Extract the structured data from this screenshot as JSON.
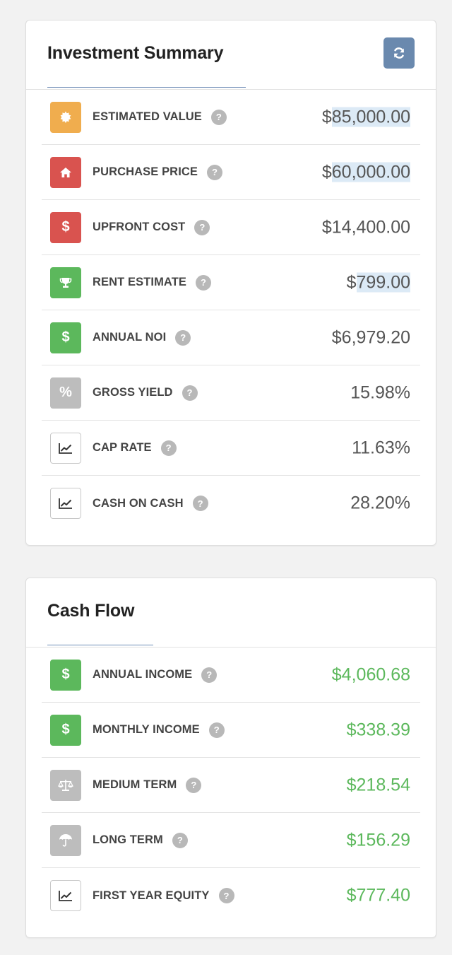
{
  "investment_summary": {
    "title": "Investment Summary",
    "refresh_icon": "refresh-icon",
    "rows": [
      {
        "label": "ESTIMATED VALUE",
        "value_prefix": "$",
        "value_main": "85,000.00",
        "icon": "certificate-icon",
        "color": "#f0ad4e"
      },
      {
        "label": "PURCHASE PRICE",
        "value_prefix": "$",
        "value_main": "60,000.00",
        "icon": "home-icon",
        "color": "#d9534f"
      },
      {
        "label": "UPFRONT COST",
        "value": "$14,400.00",
        "icon": "dollar-icon",
        "color": "#d9534f"
      },
      {
        "label": "RENT ESTIMATE",
        "value_prefix": "$",
        "value_main": "799.00",
        "icon": "trophy-icon",
        "color": "#5cb85c"
      },
      {
        "label": "ANNUAL NOI",
        "value": "$6,979.20",
        "icon": "dollar-icon",
        "color": "#5cb85c"
      },
      {
        "label": "GROSS YIELD",
        "value": "15.98%",
        "icon": "percent-icon",
        "color": "#bdbdbd"
      },
      {
        "label": "CAP RATE",
        "value": "11.63%",
        "icon": "line-chart-icon",
        "color": "#ffffff"
      },
      {
        "label": "CASH ON CASH",
        "value": "28.20%",
        "icon": "line-chart-icon",
        "color": "#ffffff"
      }
    ]
  },
  "cash_flow": {
    "title": "Cash Flow",
    "rows": [
      {
        "label": "ANNUAL INCOME",
        "value": "$4,060.68",
        "icon": "dollar-icon",
        "color": "#5cb85c"
      },
      {
        "label": "MONTHLY INCOME",
        "value": "$338.39",
        "icon": "dollar-icon",
        "color": "#5cb85c"
      },
      {
        "label": "MEDIUM TERM",
        "value": "$218.54",
        "icon": "balance-scale-icon",
        "color": "#bdbdbd"
      },
      {
        "label": "LONG TERM",
        "value": "$156.29",
        "icon": "umbrella-icon",
        "color": "#bdbdbd"
      },
      {
        "label": "FIRST YEAR EQUITY",
        "value": "$777.40",
        "icon": "line-chart-icon",
        "color": "#ffffff"
      }
    ],
    "value_color": "#5cb85c"
  },
  "help_glyph": "?",
  "dollar_glyph": "$",
  "percent_glyph": "%"
}
